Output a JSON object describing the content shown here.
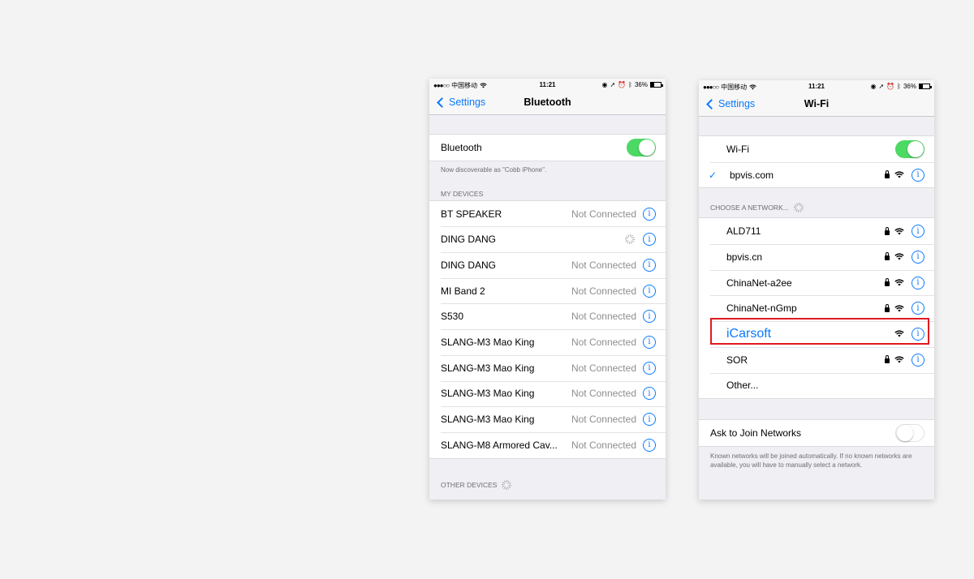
{
  "status_bar": {
    "signal": "●●●○○",
    "carrier": "中国移动",
    "time": "11:21",
    "battery": "36%",
    "status_icons": [
      "location-icon",
      "arrow-icon",
      "alarm-icon",
      "bluetooth-icon"
    ]
  },
  "bluetooth_screen": {
    "back_label": "Settings",
    "title": "Bluetooth",
    "toggle_label": "Bluetooth",
    "toggle_on": true,
    "discoverable_note": "Now discoverable as \"Cobb iPhone\".",
    "my_devices_header": "MY DEVICES",
    "devices": [
      {
        "name": "BT SPEAKER",
        "status": "Not Connected"
      },
      {
        "name": "DING  DANG",
        "status": ""
      },
      {
        "name": "DING  DANG",
        "status": "Not Connected"
      },
      {
        "name": "MI Band 2",
        "status": "Not Connected"
      },
      {
        "name": "S530",
        "status": "Not Connected"
      },
      {
        "name": "SLANG-M3 Mao King",
        "status": "Not Connected"
      },
      {
        "name": "SLANG-M3 Mao King",
        "status": "Not Connected"
      },
      {
        "name": "SLANG-M3 Mao King",
        "status": "Not Connected"
      },
      {
        "name": "SLANG-M3 Mao King",
        "status": "Not Connected"
      },
      {
        "name": "SLANG-M8 Armored Cav...",
        "status": "Not Connected"
      }
    ],
    "other_devices_header": "OTHER DEVICES"
  },
  "wifi_screen": {
    "back_label": "Settings",
    "title": "Wi-Fi",
    "toggle_label": "Wi-Fi",
    "toggle_on": true,
    "connected_network": "bpvis.com",
    "choose_header": "CHOOSE A NETWORK...",
    "networks": [
      {
        "name": "ALD711",
        "locked": true
      },
      {
        "name": "bpvis.cn",
        "locked": true
      },
      {
        "name": "ChinaNet-a2ee",
        "locked": true
      },
      {
        "name": "ChinaNet-nGmp",
        "locked": true
      },
      {
        "name": "iCarsoft",
        "locked": false,
        "highlighted": true
      },
      {
        "name": "SOR",
        "locked": true
      }
    ],
    "other_label": "Other...",
    "ask_join_label": "Ask to Join Networks",
    "ask_join_on": false,
    "ask_join_note": "Known networks will be joined automatically. If no known networks are available, you will have to manually select a network."
  },
  "colors": {
    "accent": "#0a7aff",
    "toggle_on": "#4cd964",
    "highlight_border": "#e0191f",
    "secondary_text": "#8e8e93"
  }
}
